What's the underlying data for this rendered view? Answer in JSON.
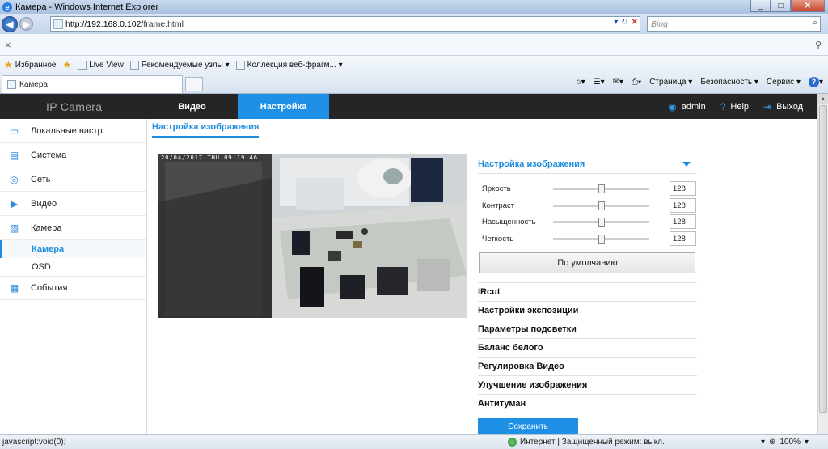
{
  "browser": {
    "window_title": "Камера - Windows Internet Explorer",
    "url_host": "http://192.168.0.102",
    "url_path": "/frame.html",
    "search_placeholder": "Bing",
    "favorites_label": "Избранное",
    "fav_items": [
      "Live View",
      "Рекомендуемые узлы ▾",
      "Коллекция веб-фрагм... ▾"
    ],
    "tab_title": "Камера",
    "cmd_items": [
      "Страница ▾",
      "Безопасность ▾",
      "Сервис ▾"
    ],
    "status_text": "javascript:void(0);",
    "zone_text": "Интернет | Защищенный режим: выкл.",
    "zoom": "100%"
  },
  "app": {
    "brand": "IP Camera",
    "nav": {
      "video": "Видео",
      "setup": "Настройка"
    },
    "user": {
      "name": "admin",
      "help": "Help",
      "logout": "Выход"
    }
  },
  "sidebar": {
    "items": [
      {
        "label": "Локальные настр.",
        "icon": "monitor-icon"
      },
      {
        "label": "Система",
        "icon": "system-icon"
      },
      {
        "label": "Сеть",
        "icon": "network-icon"
      },
      {
        "label": "Видео",
        "icon": "video-icon"
      },
      {
        "label": "Камера",
        "icon": "image-icon"
      }
    ],
    "sub": [
      "Камера",
      "OSD"
    ],
    "events": {
      "label": "События",
      "icon": "events-icon"
    }
  },
  "page": {
    "tab": "Настройка изображения",
    "osd_text": "20/04/2017 THU 09:19:46"
  },
  "panel": {
    "header": "Настройка изображения",
    "sliders": [
      {
        "label": "Яркость",
        "value": "128",
        "fraction": 0.5
      },
      {
        "label": "Контраст",
        "value": "128",
        "fraction": 0.5
      },
      {
        "label": "Насыщенность",
        "value": "128",
        "fraction": 0.5
      },
      {
        "label": "Четкость",
        "value": "128",
        "fraction": 0.5
      }
    ],
    "default_button": "По умолчанию",
    "sections": [
      "IRcut",
      "Настройки экспозиции",
      "Параметры подсветки",
      "Баланс белого",
      "Регулировка Видео",
      "Улучшение изображения",
      "Антитуман"
    ],
    "save_button": "Сохранить"
  },
  "colors": {
    "accent": "#1e90e6",
    "appbar": "#252525"
  }
}
